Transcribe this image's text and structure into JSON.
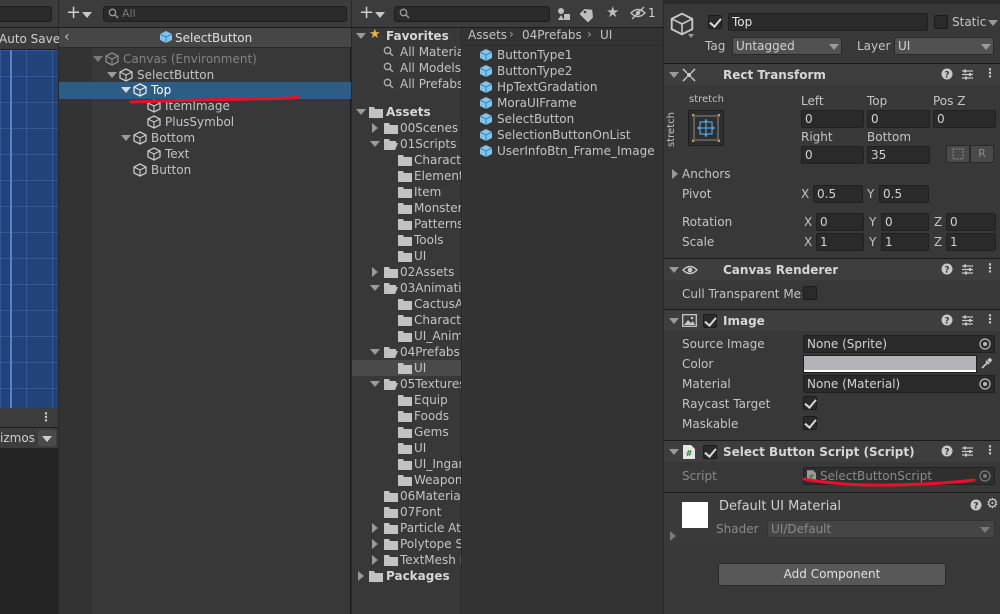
{
  "scene": {
    "search_placeholder": "",
    "auto_save": "Auto Save",
    "gizmos": "izmos"
  },
  "hierarchy": {
    "search_placeholder": "All",
    "prefab_title": "SelectButton",
    "items": [
      {
        "label": "Canvas (Environment)",
        "depth": 0
      },
      {
        "label": "SelectButton",
        "depth": 1
      },
      {
        "label": "Top",
        "depth": 2
      },
      {
        "label": "ItemImage",
        "depth": 3
      },
      {
        "label": "PlusSymbol",
        "depth": 3
      },
      {
        "label": "Bottom",
        "depth": 2
      },
      {
        "label": "Text",
        "depth": 3
      },
      {
        "label": "Button",
        "depth": 2
      }
    ]
  },
  "project": {
    "badge_count": "1",
    "favorites": {
      "label": "Favorites",
      "items": [
        "All Materia",
        "All Models",
        "All Prefabs"
      ]
    },
    "assets_label": "Assets",
    "tree": [
      {
        "label": "00Scenes",
        "depth": 1,
        "expanded": false
      },
      {
        "label": "01Scripts",
        "depth": 1,
        "expanded": true
      },
      {
        "label": "Characte",
        "depth": 2
      },
      {
        "label": "Element",
        "depth": 2
      },
      {
        "label": "Item",
        "depth": 2
      },
      {
        "label": "Monster",
        "depth": 2
      },
      {
        "label": "Patterns",
        "depth": 2
      },
      {
        "label": "Tools",
        "depth": 2
      },
      {
        "label": "UI",
        "depth": 2
      },
      {
        "label": "02Assets",
        "depth": 1,
        "expanded": false
      },
      {
        "label": "03Animatio",
        "depth": 1,
        "expanded": true
      },
      {
        "label": "CactusA",
        "depth": 2
      },
      {
        "label": "Characte",
        "depth": 2
      },
      {
        "label": "UI_Anima",
        "depth": 2
      },
      {
        "label": "04Prefabs",
        "depth": 1,
        "expanded": true
      },
      {
        "label": "UI",
        "depth": 2
      },
      {
        "label": "05Textures",
        "depth": 1,
        "expanded": true
      },
      {
        "label": "Equip",
        "depth": 2
      },
      {
        "label": "Foods",
        "depth": 2
      },
      {
        "label": "Gems",
        "depth": 2
      },
      {
        "label": "UI",
        "depth": 2
      },
      {
        "label": "UI_Ingan",
        "depth": 2
      },
      {
        "label": "Weapon",
        "depth": 2
      },
      {
        "label": "06Material",
        "depth": 1,
        "expanded": null
      },
      {
        "label": "07Font",
        "depth": 1,
        "expanded": null
      },
      {
        "label": "Particle Att",
        "depth": 1,
        "expanded": false
      },
      {
        "label": "Polytope S",
        "depth": 1,
        "expanded": false
      },
      {
        "label": "TextMesh I",
        "depth": 1,
        "expanded": false
      }
    ],
    "packages_label": "Packages",
    "breadcrumb": [
      "Assets",
      "04Prefabs",
      "UI"
    ],
    "files": [
      "ButtonType1",
      "ButtonType2",
      "HpTextGradation",
      "MoraUIFrame",
      "SelectButton",
      "SelectionButtonOnList",
      "UserInfoBtn_Frame_Image"
    ]
  },
  "inspector": {
    "object_name": "Top",
    "static_label": "Static",
    "tag_label": "Tag",
    "tag_value": "Untagged",
    "layer_label": "Layer",
    "layer_value": "UI",
    "rect_transform": {
      "title": "Rect Transform",
      "stretch_top": "stretch",
      "stretch_side": "stretch",
      "left_label": "Left",
      "left_value": "0",
      "top_label": "Top",
      "top_value": "0",
      "posz_label": "Pos Z",
      "posz_value": "0",
      "right_label": "Right",
      "right_value": "0",
      "bottom_label": "Bottom",
      "bottom_value": "35",
      "r_button": "R",
      "anchors_label": "Anchors",
      "pivot_label": "Pivot",
      "pivot_x": "0.5",
      "pivot_y": "0.5",
      "rotation_label": "Rotation",
      "rot_x": "0",
      "rot_y": "0",
      "rot_z": "0",
      "scale_label": "Scale",
      "scale_x": "1",
      "scale_y": "1",
      "scale_z": "1",
      "x": "X",
      "y": "Y",
      "z": "Z"
    },
    "canvas_renderer": {
      "title": "Canvas Renderer",
      "cull_label": "Cull Transparent Mes"
    },
    "image": {
      "title": "Image",
      "source_label": "Source Image",
      "source_value": "None (Sprite)",
      "color_label": "Color",
      "color_value": "#b4b4b8",
      "material_label": "Material",
      "material_value": "None (Material)",
      "raycast_label": "Raycast Target",
      "maskable_label": "Maskable"
    },
    "select_script": {
      "title": "Select Button Script (Script)",
      "script_label": "Script",
      "script_value": "SelectButtonScript"
    },
    "material": {
      "name": "Default UI Material",
      "shader_label": "Shader",
      "shader_value": "UI/Default"
    },
    "add_component": "Add Component"
  },
  "colors": {
    "selection": "#2c5d87",
    "annotation": "#e8102a",
    "prefab_icon": "#7fc4ee"
  }
}
